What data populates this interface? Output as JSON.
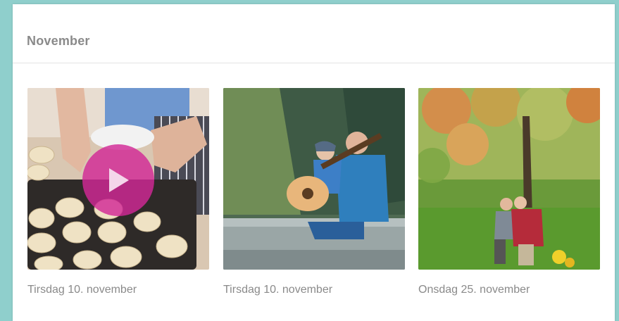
{
  "section": {
    "title": "November"
  },
  "items": [
    {
      "date": "Tirsdag 10. november",
      "type": "video",
      "icon": "play-icon"
    },
    {
      "date": "Tirsdag 10. november",
      "type": "image"
    },
    {
      "date": "Onsdag 25. november",
      "type": "image"
    }
  ],
  "colors": {
    "background": "#8fcfcc",
    "play_button": "#d2289a",
    "muted_text": "#8a8a8a"
  }
}
